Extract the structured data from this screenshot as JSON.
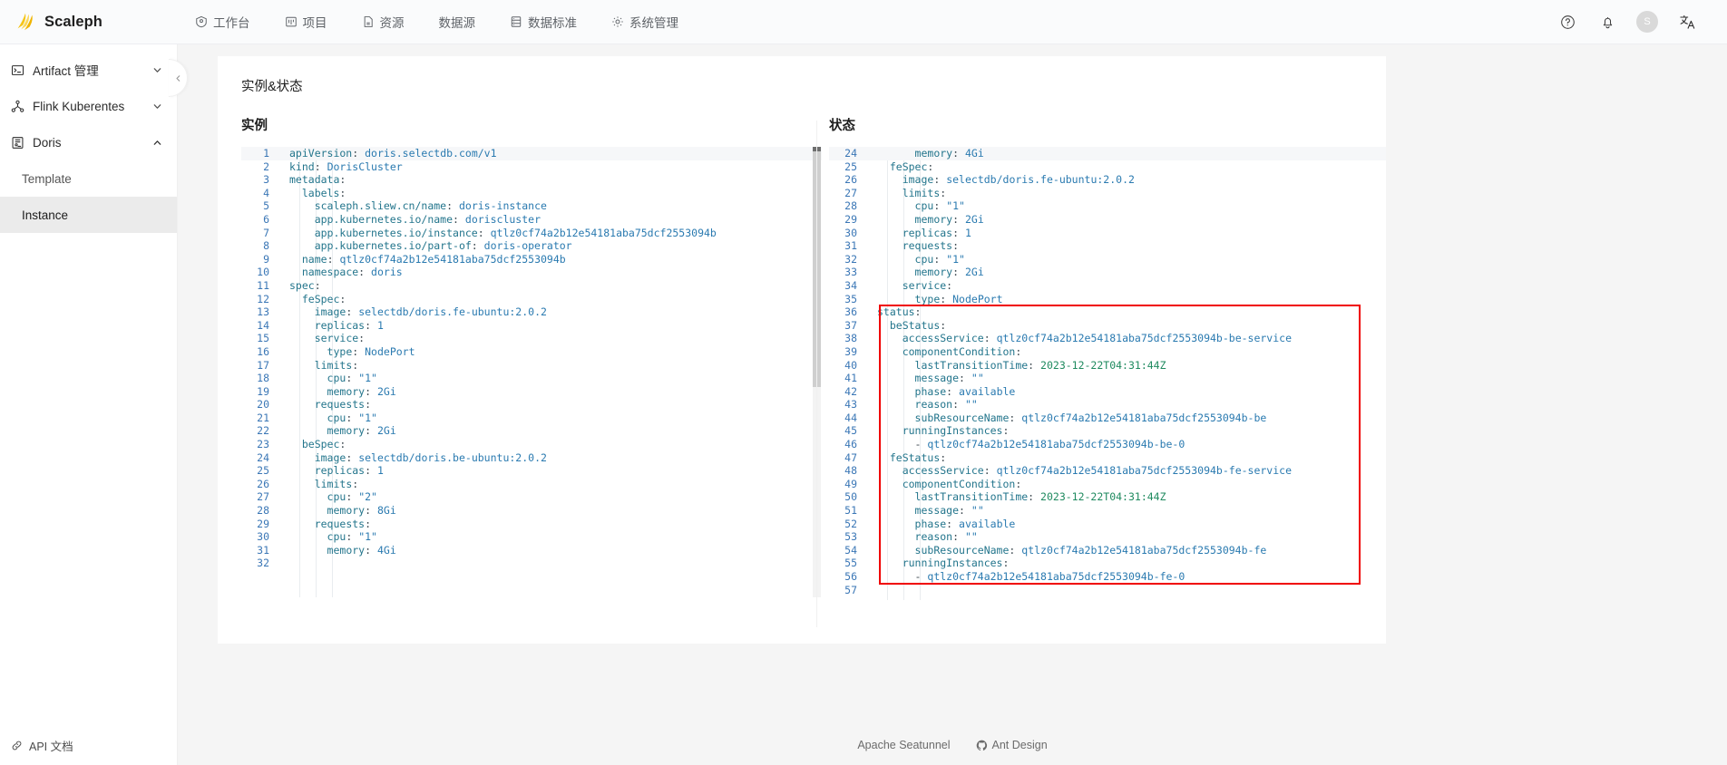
{
  "app": {
    "brand": "Scaleph"
  },
  "nav": [
    {
      "label": "工作台",
      "icon": "dashboard-icon"
    },
    {
      "label": "项目",
      "icon": "project-icon"
    },
    {
      "label": "资源",
      "icon": "file-icon"
    },
    {
      "label": "数据源",
      "icon": "none"
    },
    {
      "label": "数据标准",
      "icon": "list-icon"
    },
    {
      "label": "系统管理",
      "icon": "settings-icon"
    }
  ],
  "topbar_right": {
    "help_icon": "question-circle-icon",
    "bell_icon": "bell-icon",
    "avatar_initial": "S",
    "language_icon": "translate-icon"
  },
  "sidebar": {
    "groups": [
      {
        "label": "Artifact 管理",
        "icon": "terminal-icon",
        "expanded": false,
        "children": []
      },
      {
        "label": "Flink Kuberentes",
        "icon": "cluster-icon",
        "expanded": false,
        "children": []
      },
      {
        "label": "Doris",
        "icon": "database-doc-icon",
        "expanded": true,
        "children": [
          {
            "label": "Template",
            "active": false
          },
          {
            "label": "Instance",
            "active": true
          }
        ]
      }
    ],
    "footer": {
      "label": "API 文档",
      "icon": "link-icon"
    }
  },
  "page": {
    "title": "实例&状态",
    "left_panel_title": "实例",
    "right_panel_title": "状态"
  },
  "footer": {
    "left_text": "Apache Seatunnel",
    "right_text": "Ant Design",
    "right_icon": "github-icon"
  },
  "instance_yaml": [
    {
      "n": 1,
      "indent": 0,
      "text": "apiVersion: doris.selectdb.com/v1"
    },
    {
      "n": 2,
      "indent": 0,
      "text": "kind: DorisCluster"
    },
    {
      "n": 3,
      "indent": 0,
      "text": "metadata:"
    },
    {
      "n": 4,
      "indent": 1,
      "text": "labels:"
    },
    {
      "n": 5,
      "indent": 2,
      "text": "scaleph.sliew.cn/name: doris-instance"
    },
    {
      "n": 6,
      "indent": 2,
      "text": "app.kubernetes.io/name: doriscluster"
    },
    {
      "n": 7,
      "indent": 2,
      "text": "app.kubernetes.io/instance: qtlz0cf74a2b12e54181aba75dcf2553094b"
    },
    {
      "n": 8,
      "indent": 2,
      "text": "app.kubernetes.io/part-of: doris-operator"
    },
    {
      "n": 9,
      "indent": 1,
      "text": "name: qtlz0cf74a2b12e54181aba75dcf2553094b"
    },
    {
      "n": 10,
      "indent": 1,
      "text": "namespace: doris"
    },
    {
      "n": 11,
      "indent": 0,
      "text": "spec:"
    },
    {
      "n": 12,
      "indent": 1,
      "text": "feSpec:"
    },
    {
      "n": 13,
      "indent": 2,
      "text": "image: selectdb/doris.fe-ubuntu:2.0.2"
    },
    {
      "n": 14,
      "indent": 2,
      "text": "replicas: 1"
    },
    {
      "n": 15,
      "indent": 2,
      "text": "service:"
    },
    {
      "n": 16,
      "indent": 3,
      "text": "type: NodePort"
    },
    {
      "n": 17,
      "indent": 2,
      "text": "limits:"
    },
    {
      "n": 18,
      "indent": 3,
      "text": "cpu: \"1\""
    },
    {
      "n": 19,
      "indent": 3,
      "text": "memory: 2Gi"
    },
    {
      "n": 20,
      "indent": 2,
      "text": "requests:"
    },
    {
      "n": 21,
      "indent": 3,
      "text": "cpu: \"1\""
    },
    {
      "n": 22,
      "indent": 3,
      "text": "memory: 2Gi"
    },
    {
      "n": 23,
      "indent": 1,
      "text": "beSpec:"
    },
    {
      "n": 24,
      "indent": 2,
      "text": "image: selectdb/doris.be-ubuntu:2.0.2"
    },
    {
      "n": 25,
      "indent": 2,
      "text": "replicas: 1"
    },
    {
      "n": 26,
      "indent": 2,
      "text": "limits:"
    },
    {
      "n": 27,
      "indent": 3,
      "text": "cpu: \"2\""
    },
    {
      "n": 28,
      "indent": 3,
      "text": "memory: 8Gi"
    },
    {
      "n": 29,
      "indent": 2,
      "text": "requests:"
    },
    {
      "n": 30,
      "indent": 3,
      "text": "cpu: \"1\""
    },
    {
      "n": 31,
      "indent": 3,
      "text": "memory: 4Gi"
    },
    {
      "n": 32,
      "indent": 0,
      "text": ""
    }
  ],
  "status_yaml": [
    {
      "n": 24,
      "indent": 3,
      "text": "memory: 4Gi"
    },
    {
      "n": 25,
      "indent": 1,
      "text": "feSpec:"
    },
    {
      "n": 26,
      "indent": 2,
      "text": "image: selectdb/doris.fe-ubuntu:2.0.2"
    },
    {
      "n": 27,
      "indent": 2,
      "text": "limits:"
    },
    {
      "n": 28,
      "indent": 3,
      "text": "cpu: \"1\""
    },
    {
      "n": 29,
      "indent": 3,
      "text": "memory: 2Gi"
    },
    {
      "n": 30,
      "indent": 2,
      "text": "replicas: 1"
    },
    {
      "n": 31,
      "indent": 2,
      "text": "requests:"
    },
    {
      "n": 32,
      "indent": 3,
      "text": "cpu: \"1\""
    },
    {
      "n": 33,
      "indent": 3,
      "text": "memory: 2Gi"
    },
    {
      "n": 34,
      "indent": 2,
      "text": "service:"
    },
    {
      "n": 35,
      "indent": 3,
      "text": "type: NodePort"
    },
    {
      "n": 36,
      "indent": 0,
      "text": "status:"
    },
    {
      "n": 37,
      "indent": 1,
      "text": "beStatus:"
    },
    {
      "n": 38,
      "indent": 2,
      "text": "accessService: qtlz0cf74a2b12e54181aba75dcf2553094b-be-service"
    },
    {
      "n": 39,
      "indent": 2,
      "text": "componentCondition:"
    },
    {
      "n": 40,
      "indent": 3,
      "text": "lastTransitionTime: 2023-12-22T04:31:44Z"
    },
    {
      "n": 41,
      "indent": 3,
      "text": "message: \"\""
    },
    {
      "n": 42,
      "indent": 3,
      "text": "phase: available"
    },
    {
      "n": 43,
      "indent": 3,
      "text": "reason: \"\""
    },
    {
      "n": 44,
      "indent": 3,
      "text": "subResourceName: qtlz0cf74a2b12e54181aba75dcf2553094b-be"
    },
    {
      "n": 45,
      "indent": 2,
      "text": "runningInstances:"
    },
    {
      "n": 46,
      "indent": 3,
      "text": "- qtlz0cf74a2b12e54181aba75dcf2553094b-be-0"
    },
    {
      "n": 47,
      "indent": 1,
      "text": "feStatus:"
    },
    {
      "n": 48,
      "indent": 2,
      "text": "accessService: qtlz0cf74a2b12e54181aba75dcf2553094b-fe-service"
    },
    {
      "n": 49,
      "indent": 2,
      "text": "componentCondition:"
    },
    {
      "n": 50,
      "indent": 3,
      "text": "lastTransitionTime: 2023-12-22T04:31:44Z"
    },
    {
      "n": 51,
      "indent": 3,
      "text": "message: \"\""
    },
    {
      "n": 52,
      "indent": 3,
      "text": "phase: available"
    },
    {
      "n": 53,
      "indent": 3,
      "text": "reason: \"\""
    },
    {
      "n": 54,
      "indent": 3,
      "text": "subResourceName: qtlz0cf74a2b12e54181aba75dcf2553094b-fe"
    },
    {
      "n": 55,
      "indent": 2,
      "text": "runningInstances:"
    },
    {
      "n": 56,
      "indent": 3,
      "text": "- qtlz0cf74a2b12e54181aba75dcf2553094b-fe-0"
    },
    {
      "n": 57,
      "indent": 0,
      "text": ""
    }
  ],
  "annotation": {
    "color": "#f00000",
    "covers_lines": "36-56",
    "label": "status-section-highlight"
  }
}
